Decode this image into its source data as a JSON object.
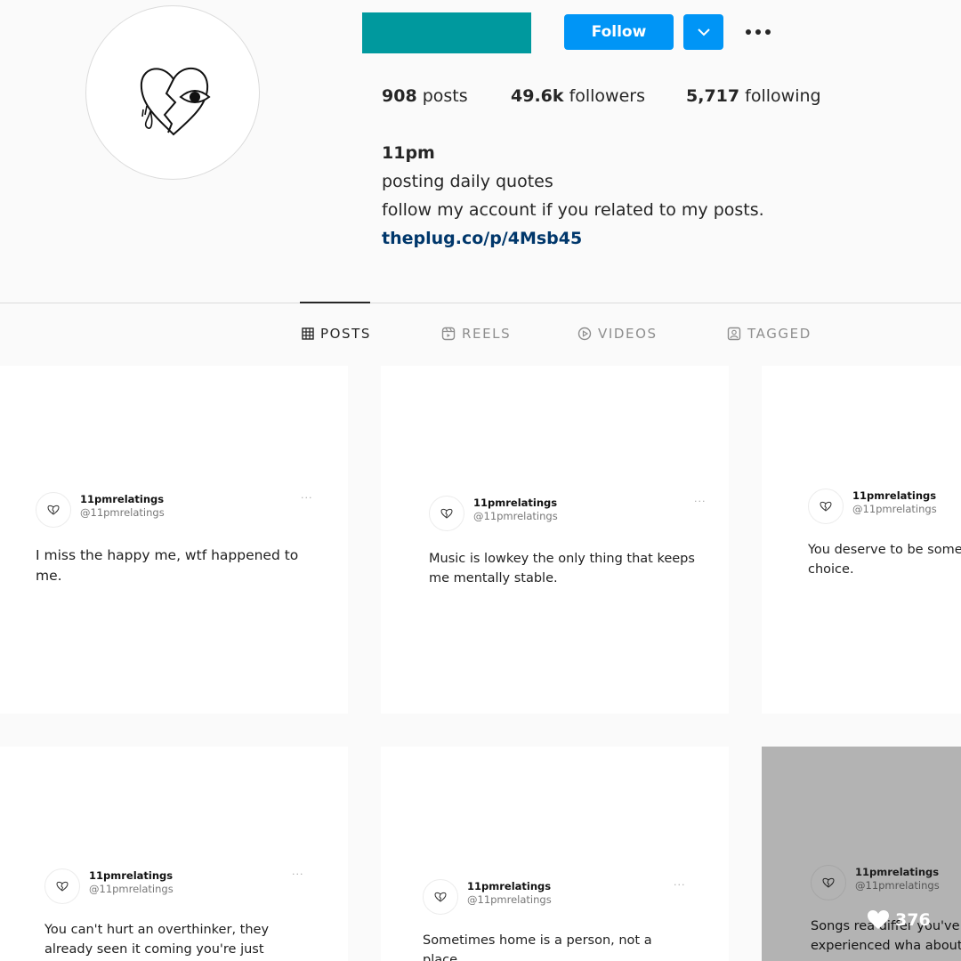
{
  "profile": {
    "follow_label": "Follow",
    "stats": {
      "posts_count": "908",
      "posts_label": "posts",
      "followers_count": "49.6k",
      "followers_label": "followers",
      "following_count": "5,717",
      "following_label": "following"
    },
    "bio": {
      "name": "11pm",
      "line1": "posting daily quotes",
      "line2": "follow my account if you related to my posts.",
      "link": "theplug.co/p/4Msb45"
    }
  },
  "tabs": [
    {
      "label": "POSTS",
      "icon": "grid-icon",
      "active": true
    },
    {
      "label": "REELS",
      "icon": "reels-icon",
      "active": false
    },
    {
      "label": "VIDEOS",
      "icon": "play-circle-icon",
      "active": false
    },
    {
      "label": "TAGGED",
      "icon": "tagged-icon",
      "active": false
    }
  ],
  "posts": [
    {
      "name": "11pmrelatings",
      "handle": "@11pmrelatings",
      "text": "I miss the happy me, wtf happened to me."
    },
    {
      "name": "11pmrelatings",
      "handle": "@11pmrelatings",
      "text": "Music is lowkey the only thing that keeps me mentally stable."
    },
    {
      "name": "11pmrelatings",
      "handle": "@11pmrelatings",
      "text": "You deserve to be some choice."
    },
    {
      "name": "11pmrelatings",
      "handle": "@11pmrelatings",
      "text": "You can't hurt an overthinker, they already seen it coming you're just"
    },
    {
      "name": "11pmrelatings",
      "handle": "@11pmrelatings",
      "text": "Sometimes home is a person, not a place."
    },
    {
      "name": "11pmrelatings",
      "handle": "@11pmrelatings",
      "text": "Songs rea     differ you've experienced wha about"
    }
  ],
  "hover": {
    "likes": "376",
    "icon": "heart-icon"
  },
  "colors": {
    "accent": "#0095f6",
    "redacted_block": "#00999e",
    "link": "#00376b"
  }
}
